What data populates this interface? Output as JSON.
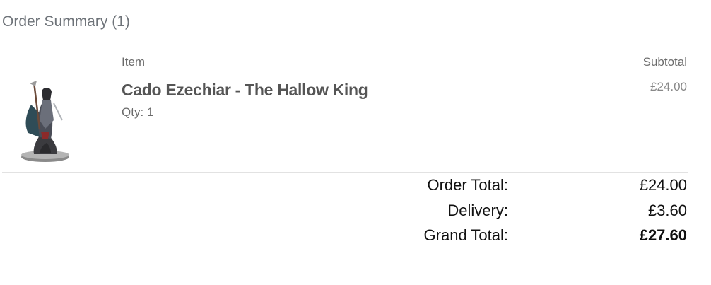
{
  "summary": {
    "title": "Order Summary (1)"
  },
  "table": {
    "item_header": "Item",
    "subtotal_header": "Subtotal"
  },
  "items": [
    {
      "name": "Cado Ezechiar - The Hallow King",
      "qty": "Qty: 1",
      "subtotal": "£24.00",
      "image_icon": "miniature-figure-image"
    }
  ],
  "totals": {
    "order_total_label": "Order Total:",
    "order_total_value": "£24.00",
    "delivery_label": "Delivery:",
    "delivery_value": "£3.60",
    "grand_total_label": "Grand Total:",
    "grand_total_value": "£27.60"
  }
}
